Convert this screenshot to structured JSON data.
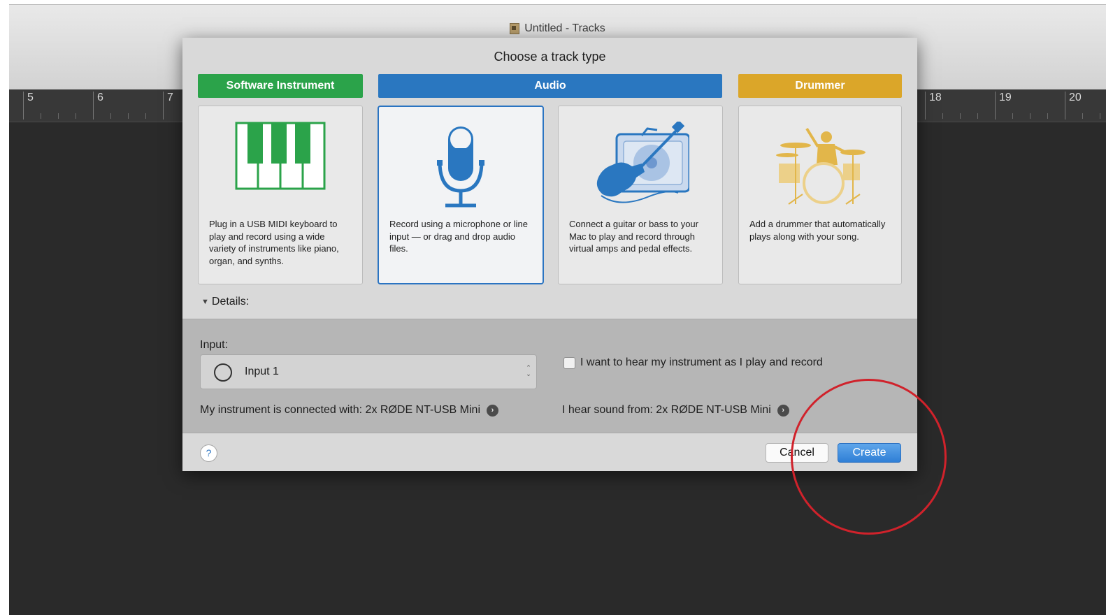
{
  "window": {
    "title": "Untitled - Tracks"
  },
  "ruler": {
    "left_numbers": [
      "5",
      "6",
      "7"
    ],
    "right_numbers": [
      "18",
      "19",
      "20"
    ]
  },
  "dialog": {
    "title": "Choose a track type",
    "track_types": [
      {
        "label": "Software Instrument",
        "color": "#2ba34a",
        "icon": "piano-keys-icon",
        "description": "Plug in a USB MIDI keyboard to play and record using a wide variety of instruments like piano, organ, and synths."
      },
      {
        "label": "Audio",
        "color": "#2a77c0",
        "icon": "microphone-icon",
        "selected": true,
        "description": "Record using a microphone or line input — or drag and drop audio files."
      },
      {
        "label": "",
        "icon": "guitar-amp-icon",
        "description": "Connect a guitar or bass to your Mac to play and record through virtual amps and pedal effects."
      },
      {
        "label": "Drummer",
        "color": "#dba629",
        "icon": "drummer-icon",
        "description": "Add a drummer that automatically plays along with your song."
      }
    ],
    "details_label": "Details:",
    "details": {
      "input_label": "Input:",
      "input_value": "Input 1",
      "monitor_label": "I want to hear my instrument as I play and record",
      "monitor_checked": false,
      "instrument_connected": "My instrument is connected with: 2x RØDE NT-USB Mini",
      "sound_from": "I hear sound from: 2x RØDE NT-USB Mini"
    },
    "help_label": "?",
    "cancel_label": "Cancel",
    "create_label": "Create"
  },
  "colors": {
    "selection_blue": "#2b74c2",
    "highlight_circle": "#d0222b"
  }
}
